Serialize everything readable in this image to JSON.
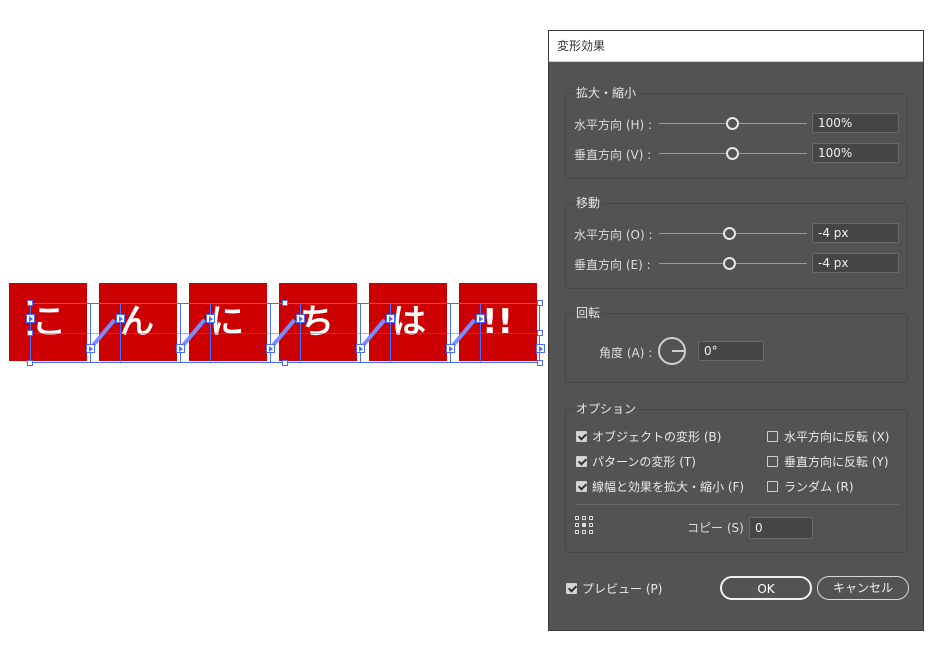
{
  "canvas": {
    "chars": [
      "こ",
      "ん",
      "に",
      "ち",
      "は",
      "!!"
    ],
    "tile_color": "#cc0000",
    "selection_color": "#4a6cff"
  },
  "dialog": {
    "title": "変形効果",
    "scale": {
      "title": "拡大・縮小",
      "horizontal_label": "水平方向 (H) :",
      "horizontal_value": "100%",
      "vertical_label": "垂直方向 (V) :",
      "vertical_value": "100%"
    },
    "move": {
      "title": "移動",
      "horizontal_label": "水平方向 (O) :",
      "horizontal_value": "-4 px",
      "vertical_label": "垂直方向 (E) :",
      "vertical_value": "-4 px"
    },
    "rotate": {
      "title": "回転",
      "angle_label": "角度 (A) :",
      "angle_value": "0°"
    },
    "options": {
      "title": "オプション",
      "transform_objects": "オブジェクトの変形 (B)",
      "transform_patterns": "パターンの変形 (T)",
      "scale_strokes": "線幅と効果を拡大・縮小 (F)",
      "reflect_x": "水平方向に反転 (X)",
      "reflect_y": "垂直方向に反転 (Y)",
      "random": "ランダム (R)",
      "copies_label": "コピー (S)",
      "copies_value": "0",
      "transform_objects_checked": true,
      "transform_patterns_checked": true,
      "scale_strokes_checked": true,
      "reflect_x_checked": false,
      "reflect_y_checked": false,
      "random_checked": false
    },
    "preview_label": "プレビュー (P)",
    "preview_checked": true,
    "ok_label": "OK",
    "cancel_label": "キャンセル"
  }
}
